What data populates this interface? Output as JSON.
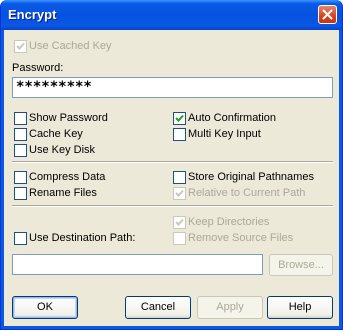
{
  "window": {
    "title": "Encrypt"
  },
  "colors": {
    "titlebar": "#0a5ae0",
    "client": "#ece9d8",
    "check": "#21a121",
    "disabled_text": "#aca899"
  },
  "icons": {
    "close": "close-icon",
    "check": "checkmark-icon"
  },
  "use_cached_key": {
    "label": "Use Cached Key",
    "checked": true,
    "enabled": false
  },
  "password": {
    "label": "Password:",
    "value": "*********"
  },
  "options": {
    "show_password": {
      "label": "Show Password",
      "checked": false
    },
    "auto_confirmation": {
      "label": "Auto Confirmation",
      "checked": true
    },
    "cache_key": {
      "label": "Cache Key",
      "checked": false
    },
    "multi_key_input": {
      "label": "Multi Key Input",
      "checked": false
    },
    "use_key_disk": {
      "label": "Use Key Disk",
      "checked": false
    },
    "compress_data": {
      "label": "Compress Data",
      "checked": false
    },
    "store_original_pathnames": {
      "label": "Store Original Pathnames",
      "checked": false
    },
    "rename_files": {
      "label": "Rename Files",
      "checked": false
    },
    "relative_to_current_path": {
      "label": "Relative to Current Path",
      "checked": true,
      "enabled": false
    },
    "keep_directories": {
      "label": "Keep Directories",
      "checked": true,
      "enabled": false
    },
    "use_destination_path": {
      "label": "Use Destination Path:",
      "checked": false
    },
    "remove_source_files": {
      "label": "Remove Source Files",
      "checked": false,
      "enabled": false
    }
  },
  "destination": {
    "value": "",
    "browse_label": "Browse..."
  },
  "buttons": {
    "ok": "OK",
    "cancel": "Cancel",
    "apply": "Apply",
    "help": "Help"
  }
}
